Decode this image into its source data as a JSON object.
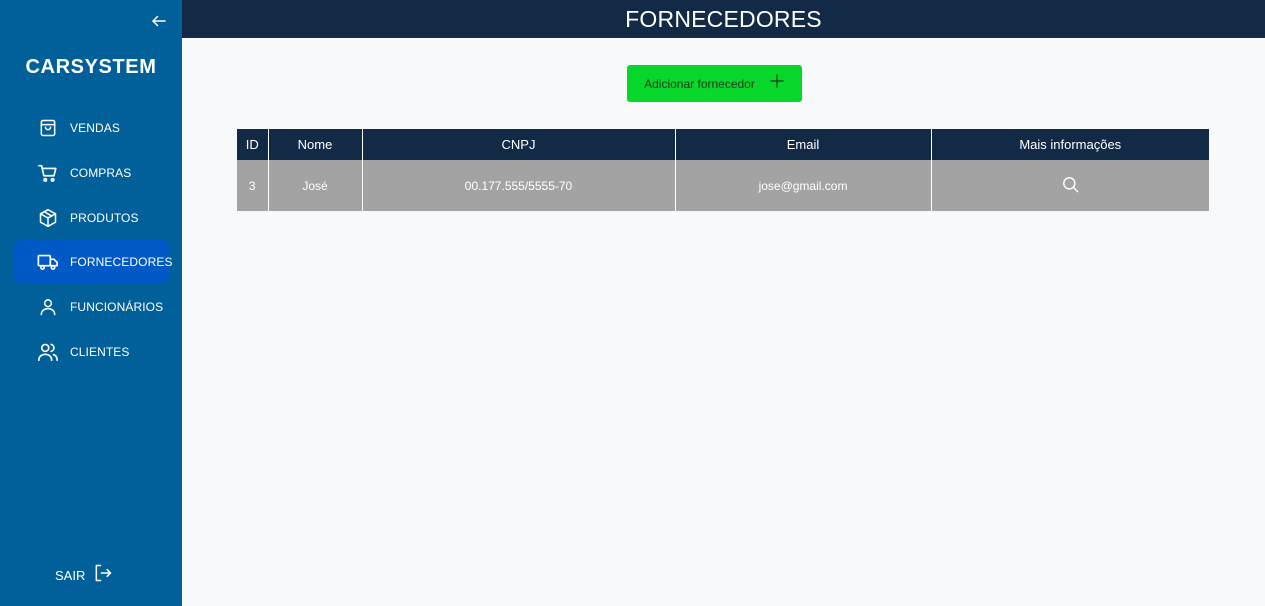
{
  "sidebar": {
    "brand": "CARSYSTEM",
    "items": [
      {
        "label": "VENDAS",
        "icon": "shopping-bag-icon"
      },
      {
        "label": "COMPRAS",
        "icon": "cart-icon"
      },
      {
        "label": "PRODUTOS",
        "icon": "box-icon"
      },
      {
        "label": "FORNECEDORES",
        "icon": "truck-icon",
        "active": true
      },
      {
        "label": "FUNCIONÁRIOS",
        "icon": "user-icon"
      },
      {
        "label": "CLIENTES",
        "icon": "users-icon"
      }
    ],
    "logout_label": "SAIR"
  },
  "header": {
    "title": "FORNECEDORES"
  },
  "toolbar": {
    "add_label": "Adicionar fornecedor"
  },
  "table": {
    "columns": [
      "ID",
      "Nome",
      "CNPJ",
      "Email",
      "Mais informações"
    ],
    "rows": [
      {
        "id": "3",
        "nome": "José",
        "cnpj": "00.177.555/5555-70",
        "email": "jose@gmail.com"
      }
    ]
  },
  "colors": {
    "sidebar_bg": "#01609a",
    "active_item_bg": "#0059c4",
    "header_bg": "#132a46",
    "add_button_bg": "#06d72a",
    "row_bg": "#a3a3a3"
  }
}
